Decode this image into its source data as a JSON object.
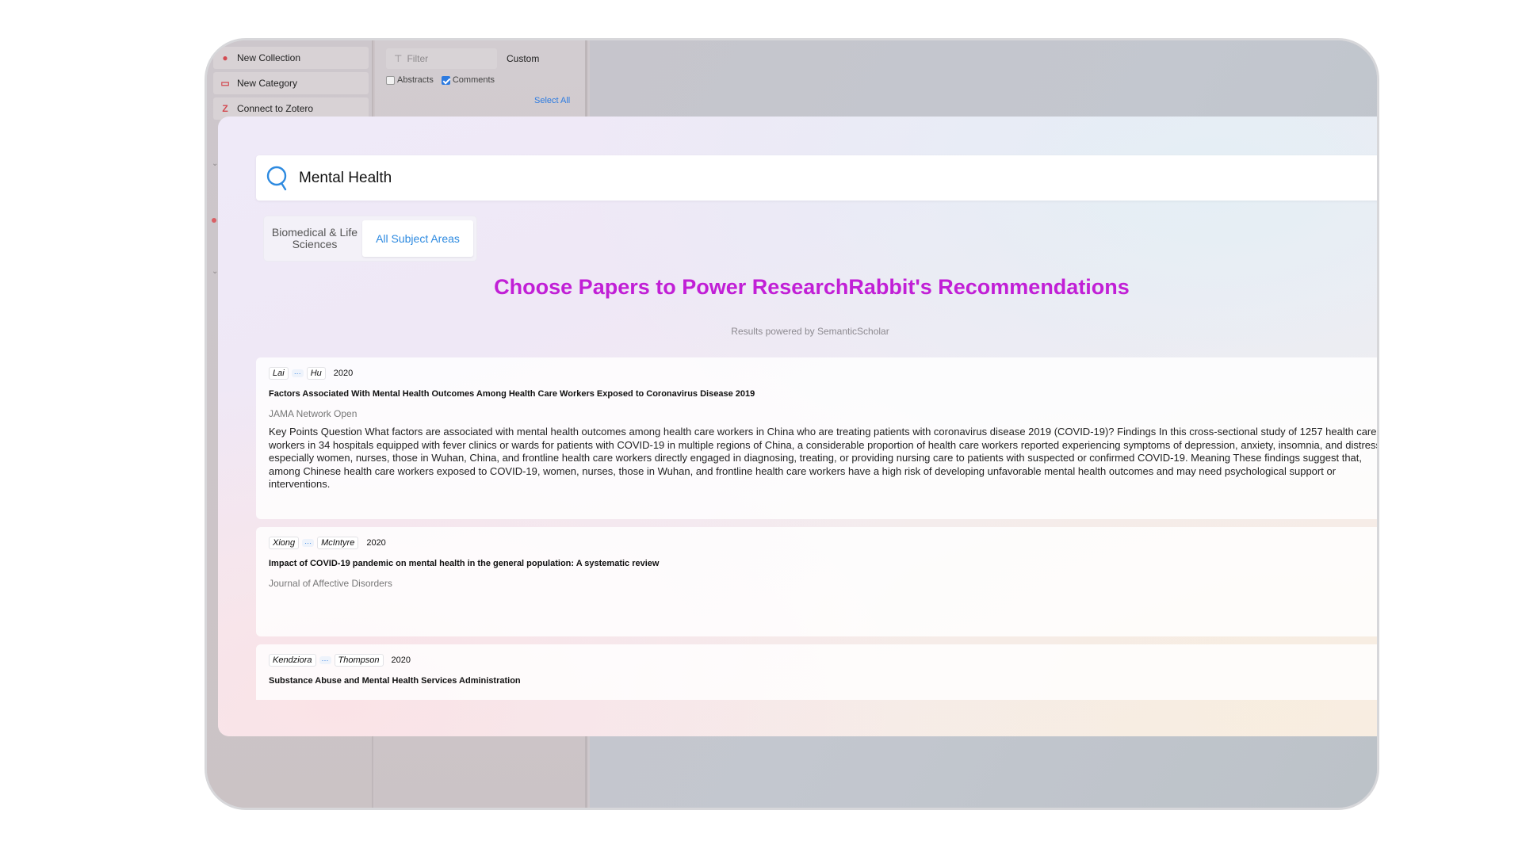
{
  "sidebar": {
    "buttons": [
      {
        "label": "New Collection",
        "icon": "collection-add-icon"
      },
      {
        "label": "New Category",
        "icon": "category-add-icon"
      },
      {
        "label": "Connect to Zotero",
        "icon": "zotero-icon"
      }
    ]
  },
  "list_panel": {
    "filter_placeholder": "Filter",
    "custom_label": "Custom",
    "abstracts_label": "Abstracts",
    "comments_label": "Comments",
    "abstracts_checked": false,
    "comments_checked": true,
    "select_all_label": "Select All"
  },
  "modal": {
    "search_value": "Mental Health",
    "tabs": [
      {
        "label": "Biomedical & Life Sciences",
        "selected": false
      },
      {
        "label": "All Subject Areas",
        "selected": true
      }
    ],
    "heading": "Choose Papers to Power ResearchRabbit's Recommendations",
    "powered_by": "Results powered by SemanticScholar",
    "accent_color": "#c11fd6",
    "results": [
      {
        "first_author": "Lai",
        "last_author": "Hu",
        "more": "···",
        "year": "2020",
        "title": "Factors Associated With Mental Health Outcomes Among Health Care Workers Exposed to Coronavirus Disease 2019",
        "journal": "JAMA Network Open",
        "abstract": "Key Points Question What factors are associated with mental health outcomes among health care workers in China who are treating patients with coronavirus disease 2019 (COVID-19)? Findings In this cross-sectional study of 1257 health care workers in 34 hospitals equipped with fever clinics or wards for patients with COVID-19 in multiple regions of China, a considerable proportion of health care workers reported experiencing symptoms of depression, anxiety, insomnia, and distress, especially women, nurses, those in Wuhan, China, and frontline health care workers directly engaged in diagnosing, treating, or providing nursing care to patients with suspected or confirmed COVID-19. Meaning These findings suggest that, among Chinese health care workers exposed to COVID-19, women, nurses, those in Wuhan, and frontline health care workers have a high risk of developing unfavorable mental health outcomes and may need psychological support or interventions."
      },
      {
        "first_author": "Xiong",
        "last_author": "McIntyre",
        "more": "···",
        "year": "2020",
        "title": "Impact of COVID-19 pandemic on mental health in the general population: A systematic review",
        "journal": "Journal of Affective Disorders",
        "abstract": ""
      },
      {
        "first_author": "Kendziora",
        "last_author": "Thompson",
        "more": "···",
        "year": "2020",
        "title": "Substance Abuse and Mental Health Services Administration",
        "journal": "",
        "abstract": ""
      }
    ]
  }
}
